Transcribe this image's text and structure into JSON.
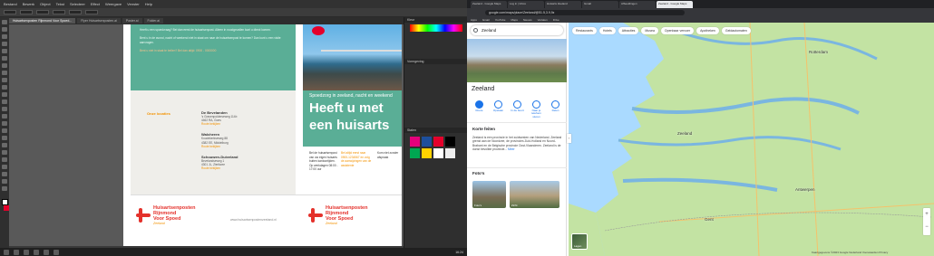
{
  "illustrator": {
    "menu": [
      "Bestand",
      "Bewerk",
      "Object",
      "Tekst",
      "Selecteer",
      "Effect",
      "Weergave",
      "Venster",
      "Help"
    ],
    "tabs": [
      "Huisartsenposten Rijnmond Voor Spoed...",
      "Flyer Huisartsenposten.ai",
      "Poster.ai",
      "Folder.ai"
    ],
    "artboard": {
      "intro_text": "Heeft u een spoedvraag? Bel dan eerst de huisartsenpost. Alleen in noodgevallen kunt u direct komen.",
      "intro_text2": "Bent u in de avond, nacht of weekend niet in staat om naar de huisartsenpost te komen? Dan kunt u een visite aanvragen.",
      "phone_line": "Bent u niet in staat te bellen? Bel dan altijd: 0900 - 0000000",
      "locations_title": "Onze locaties",
      "locations": [
        {
          "name": "De Bevelanden",
          "addr1": "'s Gravenpolderseweg 114b",
          "addr2": "4462 RA, Goes",
          "route": "Route bekijken"
        },
        {
          "name": "Walcheren",
          "addr1": "Koudekerkseweg 88",
          "addr2": "4382 EE, Middelburg",
          "route": "Route bekijken"
        },
        {
          "name": "Schouwen-Duiveland",
          "addr1": "Bevelandseweg 1",
          "addr2": "4301 JL, Zierikzee",
          "route": "Route bekijken"
        }
      ],
      "speeding_small": "Spoedzorg in zeeland, nacht en weekend",
      "headline1": "Heeft u met",
      "headline2": "een huisarts",
      "info_col1": "Bel de huisartsenpost van uw eigen huisarts buiten kantoortijden.",
      "info_col1b": "Op werkdagen 08:00 - 17:00 uur",
      "info_col2": "Bel altijd eerst naar 0900-1234567 en volg de aanwijzingen van de assistente",
      "info_col3": "Kom niet zonder afspraak",
      "logo_line1": "Huisartsenposten",
      "logo_line2": "Rijnmond",
      "logo_line3": "Voor Spoed",
      "logo_sub": "Zeeland",
      "website": "www.huisartsenpostenzeeland.nl"
    },
    "panels": {
      "color": "Kleur",
      "swatches": "Stalen",
      "appearance": "Vormgeving"
    },
    "swatch_colors": [
      "#e4007c",
      "#1d4f9c",
      "#e4002b",
      "#000000",
      "#00a651",
      "#ffd200",
      "#ffffff",
      "#eeeeee"
    ],
    "status": {
      "zoom": "66,67%",
      "artboard": "1",
      "mode": "Selecteren"
    },
    "clock": "16:24"
  },
  "browser": {
    "tabs": [
      "Zeeland - Google Maps",
      "Log in | Inbox",
      "Huisarts Zeeland",
      "Gmail",
      "Afbeeldingen",
      "Zeeland - Google Maps"
    ],
    "active_tab_index": 5,
    "url": "google.com/maps/place/Zeeland/@51.5,3.9,9z",
    "bookmarks": [
      "Apps",
      "Gmail",
      "YouTube",
      "Maps",
      "Nieuws",
      "Vertalen",
      "Drive"
    ],
    "search_value": "Zeeland",
    "place_title": "Zeeland",
    "actions": [
      "Route",
      "Opslaan",
      "In de buurt",
      "Naar je telefoon sturen",
      "Delen"
    ],
    "summary_header": "Korte feiten",
    "summary_text": "Zeeland is een provincie in het zuidwesten van Nederland. Zeeland grenst aan de Noordzee, de provincies Zuid-Holland en Noord-Brabant en de Belgische provincie Oost-Vlaanderen. Zeeland is de dunst bevolkte provincie...",
    "summary_more": "Meer",
    "photos_header": "Foto's",
    "photos": [
      "Foto's",
      "Zicht"
    ],
    "chips": [
      "Restaurants",
      "Hotels",
      "Attracties",
      "Musea",
      "Openbaar vervoer",
      "Apotheken",
      "Geldautomaten"
    ],
    "map_labels": {
      "rotterdam": "Rotterdam",
      "antwerp": "Antwerpen",
      "ghent": "Gent",
      "zeeland": "Zeeland"
    },
    "layers_label": "Lagen",
    "footer": "Kaartgegevens ©2023 Google  Nederland  Voorwaarden  Privacy"
  }
}
